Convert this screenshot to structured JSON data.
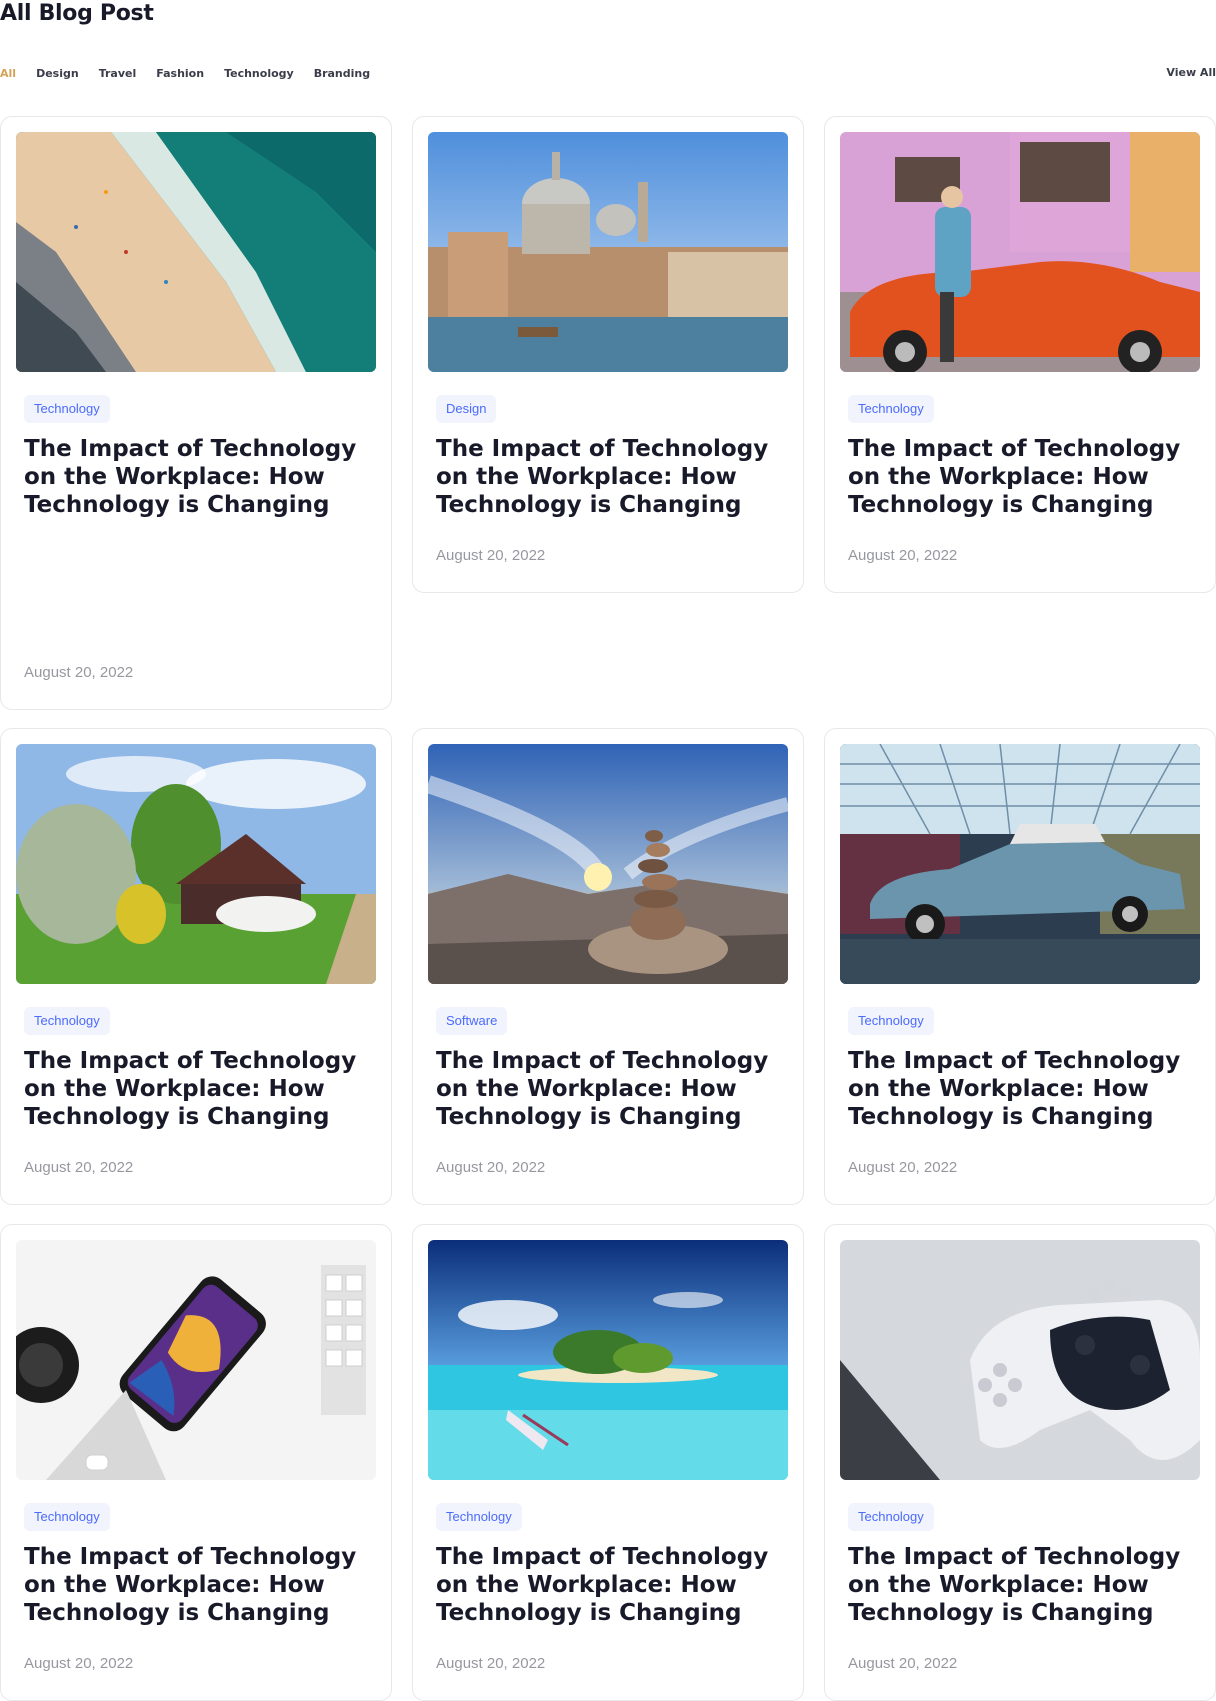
{
  "header": {
    "title": "All Blog Post",
    "filters": [
      "All",
      "Design",
      "Travel",
      "Fashion",
      "Technology",
      "Branding"
    ],
    "active_filter": "All",
    "view_all_label": "View All"
  },
  "colors": {
    "accent": "#d4a259",
    "badge_text": "#4b6bfb",
    "badge_bg": "#f1f3fd",
    "title": "#181a2a",
    "muted": "#97989f"
  },
  "posts": [
    {
      "category": "Technology",
      "title": "The Impact of Technology on the Workplace: How Technology is Changing",
      "date": "August 20, 2022",
      "image": "beach-aerial"
    },
    {
      "category": "Design",
      "title": "The Impact of Technology on the Workplace: How Technology is Changing",
      "date": "August 20, 2022",
      "image": "venice-canal"
    },
    {
      "category": "Technology",
      "title": "The Impact of Technology on the Workplace: How Technology is Changing",
      "date": "August 20, 2022",
      "image": "woman-orange-car"
    },
    {
      "category": "Technology",
      "title": "The Impact of Technology on the Workplace: How Technology is Changing",
      "date": "August 20, 2022",
      "image": "cottage-meadow"
    },
    {
      "category": "Software",
      "title": "The Impact of Technology on the Workplace: How Technology is Changing",
      "date": "August 20, 2022",
      "image": "stone-cairn-sunset"
    },
    {
      "category": "Technology",
      "title": "The Impact of Technology on the Workplace: How Technology is Changing",
      "date": "August 20, 2022",
      "image": "vintage-blue-car"
    },
    {
      "category": "Technology",
      "title": "The Impact of Technology on the Workplace: How Technology is Changing",
      "date": "August 20, 2022",
      "image": "smartphone-desk"
    },
    {
      "category": "Technology",
      "title": "The Impact of Technology on the Workplace: How Technology is Changing",
      "date": "August 20, 2022",
      "image": "tropical-island"
    },
    {
      "category": "Technology",
      "title": "The Impact of Technology on the Workplace: How Technology is Changing",
      "date": "August 20, 2022",
      "image": "game-controller"
    }
  ]
}
